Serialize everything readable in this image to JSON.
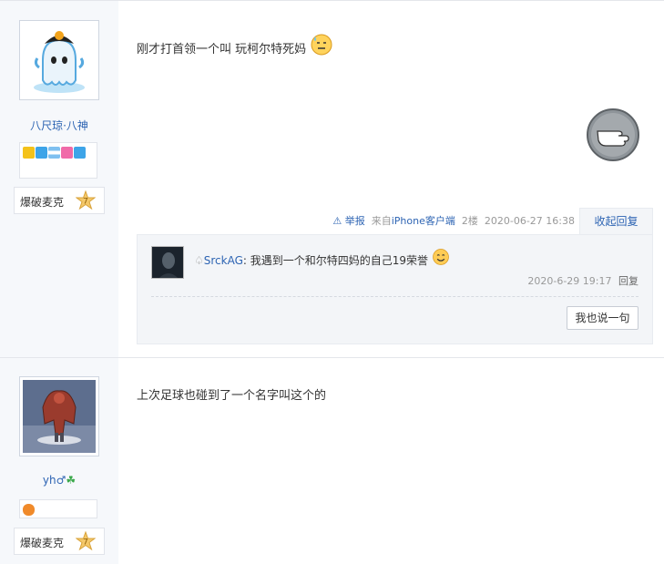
{
  "posts": [
    {
      "username": "八尺琼·八神",
      "rank_name": "爆破麦克",
      "rank_level": "7",
      "text": "刚才打首领一个叫 玩柯尔特死妈",
      "meta": {
        "report": "举报",
        "from_prefix": "来自",
        "client": "iPhone客户端",
        "floor": "2楼",
        "time": "2020-06-27 16:38"
      },
      "collapse_label": "收起回复",
      "reply": {
        "name": "SrckAG",
        "separator": ":",
        "text": "我遇到一个和尔特四妈的自己19荣誉",
        "time": "2020-6-29 19:17",
        "reply_label": "回复"
      },
      "say_label": "我也说一句"
    },
    {
      "username": "yh♂",
      "rank_name": "爆破麦克",
      "rank_level": "7",
      "text": "上次足球也碰到了一个名字叫这个的"
    }
  ]
}
